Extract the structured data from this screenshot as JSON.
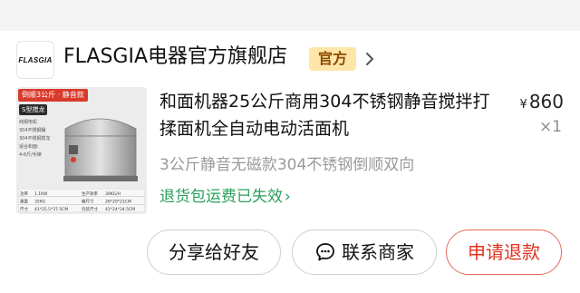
{
  "store": {
    "logo_text": "FLASGIA",
    "name": "FLASGIA电器官方旗舰店",
    "badge": "官方"
  },
  "product": {
    "image": {
      "tag_top": "倒顺3公斤 · 静音款",
      "tag_model": "S型搅龙",
      "specs": [
        "纯铜电机",
        "304不锈钢桶",
        "304不锈钢搅龙",
        "适合和面:",
        "4-6斤/手擀"
      ],
      "table_rows": [
        [
          "功率",
          "1.1KW",
          "生产效率",
          "30KG/H"
        ],
        [
          "重量",
          "35KG",
          "桶尺寸",
          "26*20*21CM"
        ],
        [
          "尺寸",
          "41*25.5*37.5CM",
          "包装尺寸",
          "41*24*34.5CM"
        ]
      ]
    },
    "title": "和面机器25公斤商用304不锈钢静音搅拌打揉面机全自动电动活面机",
    "price_currency": "¥",
    "price_value": "860",
    "quantity": "×1",
    "variant": "3公斤静音无磁款304不锈钢倒顺双向",
    "policy": "退货包运费已失效",
    "policy_chevron": "›"
  },
  "buttons": {
    "share": "分享给好友",
    "contact": "联系商家",
    "refund": "申请退款"
  },
  "colors": {
    "badge_bg": "#fde6a8",
    "policy_green": "#2aa05a",
    "refund_red": "#e0321f"
  }
}
